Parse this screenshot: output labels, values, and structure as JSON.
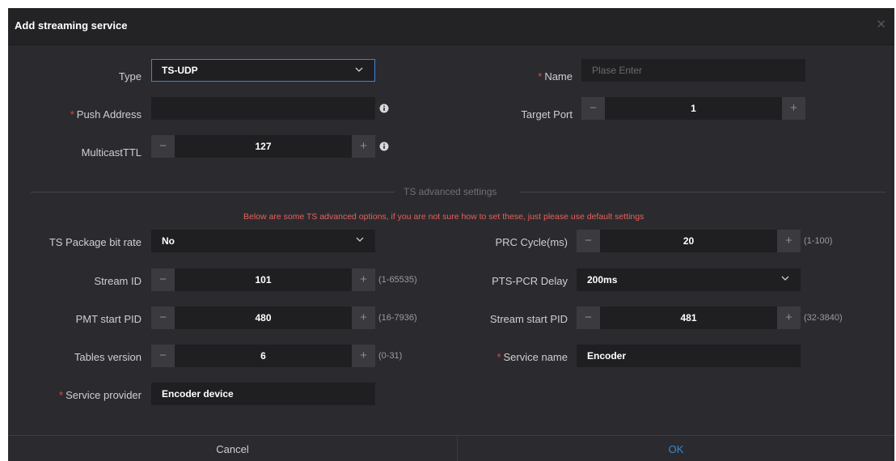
{
  "dialog": {
    "title": "Add streaming service",
    "close_icon": "close-icon"
  },
  "form": {
    "type": {
      "label": "Type",
      "value": "TS-UDP"
    },
    "name": {
      "required_mark": "*",
      "label": "Name",
      "placeholder": "Plase Enter",
      "value": ""
    },
    "push_address": {
      "required_mark": "*",
      "label": "Push Address",
      "value": ""
    },
    "target_port": {
      "label": "Target Port",
      "value": "1"
    },
    "multicast_ttl": {
      "label": "MulticastTTL",
      "value": "127"
    }
  },
  "advanced": {
    "section_title": "TS advanced settings",
    "warning": "Below are some TS advanced options, if you are not sure how to set these, just please use default settings",
    "ts_package_bit_rate": {
      "label": "TS Package bit rate",
      "value": "No"
    },
    "prc_cycle": {
      "label": "PRC Cycle(ms)",
      "value": "20",
      "range": "(1-100)"
    },
    "stream_id": {
      "label": "Stream ID",
      "value": "101",
      "range": "(1-65535)"
    },
    "pts_pcr_delay": {
      "label": "PTS-PCR Delay",
      "value": "200ms"
    },
    "pmt_start_pid": {
      "label": "PMT start PID",
      "value": "480",
      "range": "(16-7936)"
    },
    "stream_start_pid": {
      "label": "Stream start PID",
      "value": "481",
      "range": "(32-3840)"
    },
    "tables_version": {
      "label": "Tables version",
      "value": "6",
      "range": "(0-31)"
    },
    "service_name": {
      "required_mark": "*",
      "label": "Service name",
      "value": "Encoder"
    },
    "service_provider": {
      "required_mark": "*",
      "label": "Service provider",
      "value": "Encoder device"
    }
  },
  "stepper": {
    "minus": "−",
    "plus": "+"
  },
  "footer": {
    "cancel": "Cancel",
    "ok": "OK"
  },
  "colors": {
    "accent": "#3a86d8",
    "required": "#e04646",
    "warning": "#e8605a",
    "background": "#2b2b2f"
  }
}
